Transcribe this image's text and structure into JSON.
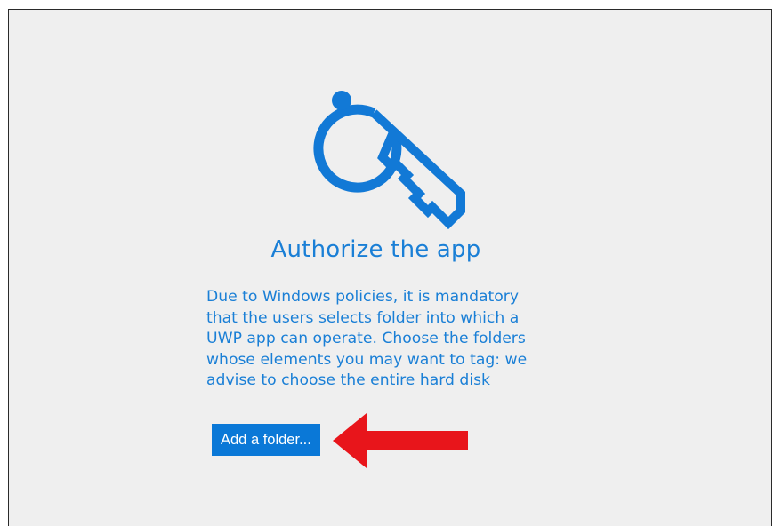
{
  "auth": {
    "title": "Authorize the app",
    "description_lines": [
      "Due to Windows policies, it is mandatory",
      "that the users selects folder into which a",
      "UWP app can operate. Choose the folders",
      "whose elements you may want to tag: we",
      "advise to choose the entire hard disk"
    ],
    "add_button_label": "Add a folder..."
  },
  "icons": {
    "key": "key-icon",
    "arrow": "red-arrow-annotation"
  },
  "colors": {
    "accent": "#1a7fd6",
    "button_bg": "#0a78d7",
    "button_text": "#ffffff",
    "background": "#efefef",
    "arrow": "#e8151b"
  }
}
